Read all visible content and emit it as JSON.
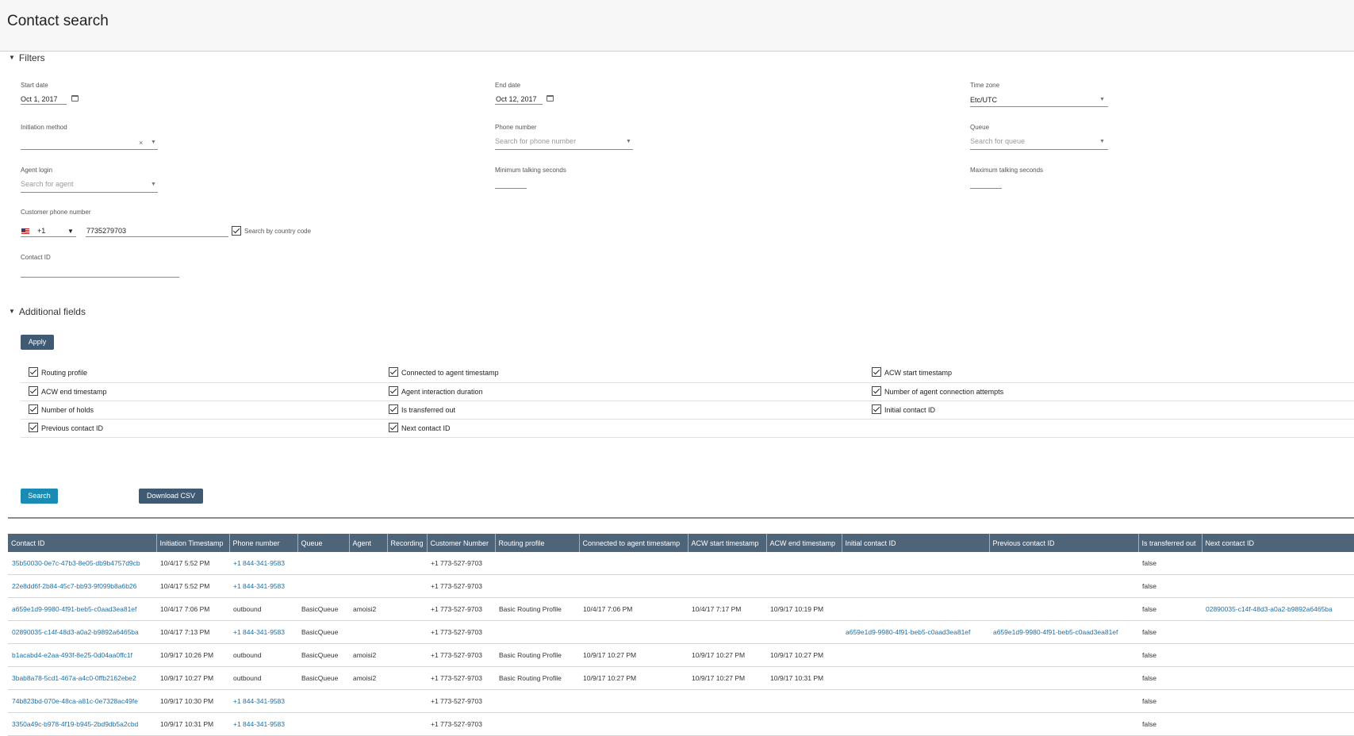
{
  "page": {
    "title": "Contact search"
  },
  "filters": {
    "section_label": "Filters",
    "start_date": {
      "label": "Start date",
      "value": "Oct 1, 2017"
    },
    "end_date": {
      "label": "End date",
      "value": "Oct 12, 2017"
    },
    "time_zone": {
      "label": "Time zone",
      "value": "Etc/UTC"
    },
    "initiation_method": {
      "label": "Initiation method",
      "value": "",
      "clear_glyph": "×"
    },
    "phone_number": {
      "label": "Phone number",
      "placeholder": "Search for phone number"
    },
    "queue": {
      "label": "Queue",
      "placeholder": "Search for queue"
    },
    "agent_login": {
      "label": "Agent login",
      "placeholder": "Search for agent"
    },
    "min_talking": {
      "label": "Minimum talking seconds",
      "value": ""
    },
    "max_talking": {
      "label": "Maximum talking seconds",
      "value": ""
    },
    "customer_phone": {
      "label": "Customer phone number",
      "country_code": "+1",
      "value": "7735279703",
      "search_by_country_code": "Search by country code"
    },
    "contact_id": {
      "label": "Contact ID",
      "value": ""
    }
  },
  "additional": {
    "section_label": "Additional fields",
    "apply_label": "Apply",
    "fields": [
      "Routing profile",
      "Connected to agent timestamp",
      "ACW start timestamp",
      "ACW end timestamp",
      "Agent interaction duration",
      "Number of agent connection attempts",
      "Number of holds",
      "Is transferred out",
      "Initial contact ID",
      "Previous contact ID",
      "Next contact ID"
    ]
  },
  "actions": {
    "search_label": "Search",
    "download_label": "Download CSV"
  },
  "table": {
    "columns": [
      "Contact ID",
      "Initiation Timestamp",
      "Phone number",
      "Queue",
      "Agent",
      "Recording",
      "Customer Number",
      "Routing profile",
      "Connected to agent timestamp",
      "ACW start timestamp",
      "ACW end timestamp",
      "Initial contact ID",
      "Previous contact ID",
      "Is transferred out",
      "Next contact ID"
    ],
    "rows": [
      [
        "35b50030-0e7c-47b3-8e05-db9b4757d9cb",
        "10/4/17 5:52 PM",
        "+1 844-341-9583",
        "",
        "",
        "",
        "+1 773-527-9703",
        "",
        "",
        "",
        "",
        "",
        "",
        "false",
        ""
      ],
      [
        "22e8dd6f-2b84-45c7-bb93-9f099b8a6b26",
        "10/4/17 5:52 PM",
        "+1 844-341-9583",
        "",
        "",
        "",
        "+1 773-527-9703",
        "",
        "",
        "",
        "",
        "",
        "",
        "false",
        ""
      ],
      [
        "a659e1d9-9980-4f91-beb5-c0aad3ea81ef",
        "10/4/17 7:06 PM",
        "outbound",
        "BasicQueue",
        "amoisi2",
        "",
        "+1 773-527-9703",
        "Basic Routing Profile",
        "10/4/17 7:06 PM",
        "10/4/17 7:17 PM",
        "10/9/17 10:19 PM",
        "",
        "",
        "false",
        "02890035-c14f-48d3-a0a2-b9892a6465ba"
      ],
      [
        "02890035-c14f-48d3-a0a2-b9892a6465ba",
        "10/4/17 7:13 PM",
        "+1 844-341-9583",
        "BasicQueue",
        "",
        "",
        "+1 773-527-9703",
        "",
        "",
        "",
        "",
        "a659e1d9-9980-4f91-beb5-c0aad3ea81ef",
        "a659e1d9-9980-4f91-beb5-c0aad3ea81ef",
        "false",
        ""
      ],
      [
        "b1acabd4-e2aa-493f-8e25-0d04aa0ffc1f",
        "10/9/17 10:26 PM",
        "outbound",
        "BasicQueue",
        "amoisi2",
        "",
        "+1 773-527-9703",
        "Basic Routing Profile",
        "10/9/17 10:27 PM",
        "10/9/17 10:27 PM",
        "10/9/17 10:27 PM",
        "",
        "",
        "false",
        ""
      ],
      [
        "3bab8a78-5cd1-467a-a4c0-0ffb2162ebe2",
        "10/9/17 10:27 PM",
        "outbound",
        "BasicQueue",
        "amoisi2",
        "",
        "+1 773-527-9703",
        "Basic Routing Profile",
        "10/9/17 10:27 PM",
        "10/9/17 10:27 PM",
        "10/9/17 10:31 PM",
        "",
        "",
        "false",
        ""
      ],
      [
        "74b823bd-070e-48ca-a81c-0e7328ac49fe",
        "10/9/17 10:30 PM",
        "+1 844-341-9583",
        "",
        "",
        "",
        "+1 773-527-9703",
        "",
        "",
        "",
        "",
        "",
        "",
        "false",
        ""
      ],
      [
        "3350a49c-b978-4f19-b945-2bd9db5a2cbd",
        "10/9/17 10:31 PM",
        "+1 844-341-9583",
        "",
        "",
        "",
        "+1 773-527-9703",
        "",
        "",
        "",
        "",
        "",
        "",
        "false",
        ""
      ]
    ]
  },
  "colors": {
    "header_bg": "#4e6479",
    "link": "#1f6fa8",
    "search_button": "#1a8bb3",
    "dark_button": "#405a73"
  }
}
